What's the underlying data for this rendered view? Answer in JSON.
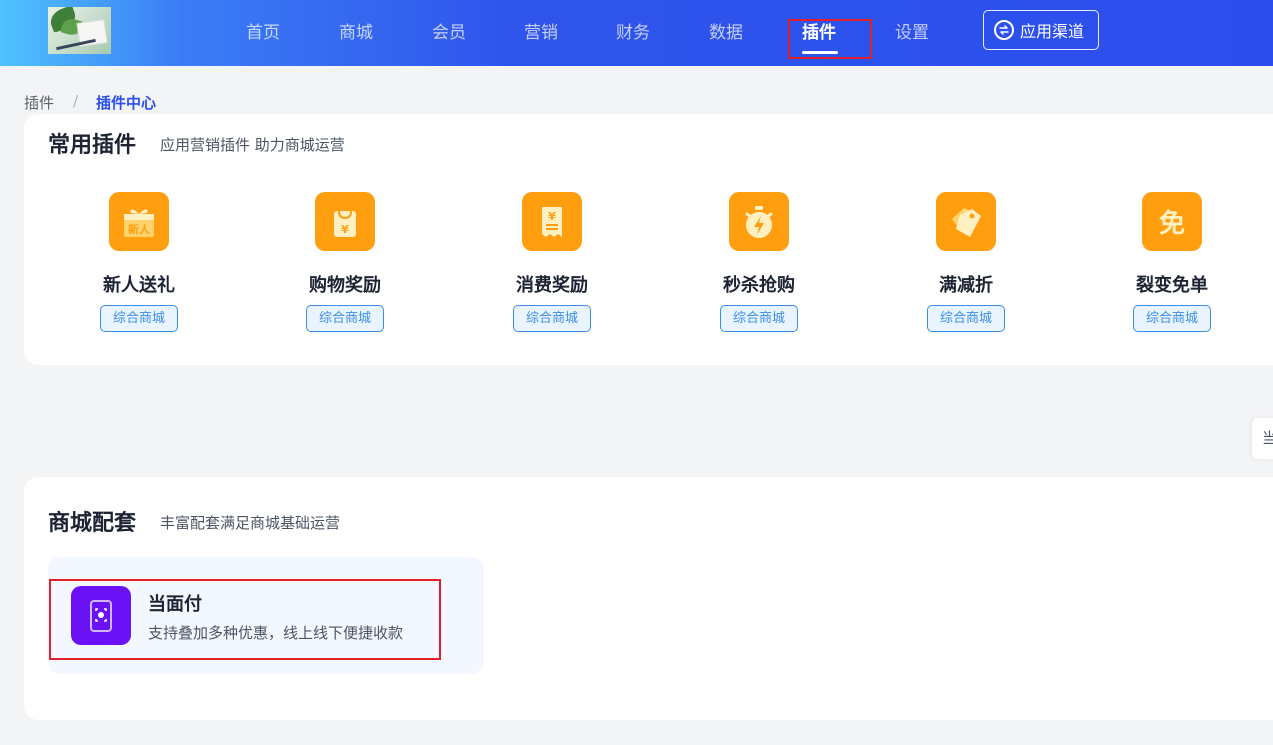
{
  "nav": {
    "items": [
      {
        "label": "首页"
      },
      {
        "label": "商城"
      },
      {
        "label": "会员"
      },
      {
        "label": "营销"
      },
      {
        "label": "财务"
      },
      {
        "label": "数据"
      },
      {
        "label": "插件",
        "active": true
      },
      {
        "label": "设置"
      }
    ],
    "channel_button": "应用渠道",
    "channel_icon": "switch-icon"
  },
  "breadcrumb": {
    "home": "插件",
    "separator": "/",
    "current": "插件中心"
  },
  "common_plugins": {
    "title": "常用插件",
    "subtitle": "应用营销插件 助力商城运营",
    "items": [
      {
        "name": "新人送礼",
        "tag": "综合商城",
        "icon": "gift-icon",
        "icon_text": "新人"
      },
      {
        "name": "购物奖励",
        "tag": "综合商城",
        "icon": "shopping-bag-yen-icon"
      },
      {
        "name": "消费奖励",
        "tag": "综合商城",
        "icon": "receipt-yen-icon"
      },
      {
        "name": "秒杀抢购",
        "tag": "综合商城",
        "icon": "stopwatch-lightning-icon"
      },
      {
        "name": "满减折",
        "tag": "综合商城",
        "icon": "price-tag-icon"
      },
      {
        "name": "裂变免单",
        "tag": "综合商城",
        "icon": "free-badge-icon",
        "icon_text": "免"
      }
    ]
  },
  "side_tab": {
    "label": "当"
  },
  "mall_kit": {
    "title": "商城配套",
    "subtitle": "丰富配套满足商城基础运营",
    "items": [
      {
        "name": "当面付",
        "desc": "支持叠加多种优惠，线上线下便捷收款",
        "icon": "scan-pay-icon"
      }
    ]
  },
  "colors": {
    "primary": "#2b4ded",
    "plugin_icon_bg": "#ff9f0f",
    "kit_icon_bg": "#6b11f5",
    "tag_blue": "#3a8ee6",
    "highlight_red": "#e0202a"
  }
}
